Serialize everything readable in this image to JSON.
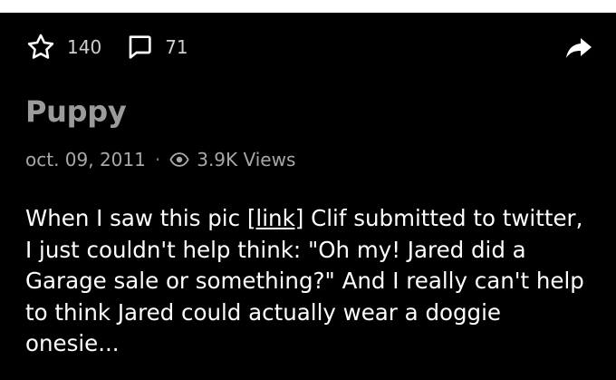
{
  "post": {
    "star_count": "140",
    "comment_count": "71",
    "title": "Puppy",
    "date": "oct. 09, 2011",
    "separator": "·",
    "views": "3.9K Views",
    "body_before_link": "When I saw this pic ",
    "link_text": "[link]",
    "body_after_link": " Clif submitted to twitter, I just couldn't help think: \"Oh my! Jared did a Garage sale or something?\" And I really can't help to think Jared could actually wear a doggie onesie..."
  },
  "icons": {
    "star": "star-icon",
    "comment": "comment-icon",
    "share": "share-icon",
    "views": "eye-icon"
  },
  "colors": {
    "background": "#000000",
    "title": "#9b9b9b",
    "meta": "#a8a8a8",
    "body": "#ffffff"
  }
}
